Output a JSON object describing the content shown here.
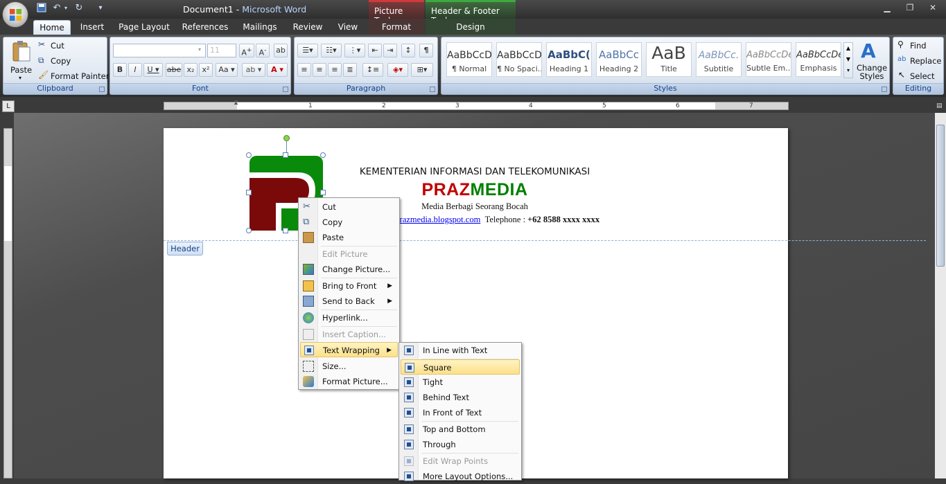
{
  "window": {
    "doc_name": "Document1",
    "app_name": "Microsoft Word",
    "separator": " - "
  },
  "contextual_tabs": {
    "picture_tools": "Picture Tools",
    "header_footer_tools": "Header & Footer Tools",
    "format": "Format",
    "design": "Design"
  },
  "tabs": [
    "Home",
    "Insert",
    "Page Layout",
    "References",
    "Mailings",
    "Review",
    "View"
  ],
  "clipboard": {
    "paste": "Paste",
    "cut": "Cut",
    "copy": "Copy",
    "format_painter": "Format Painter",
    "label": "Clipboard"
  },
  "font": {
    "size_value": "11",
    "label": "Font"
  },
  "paragraph": {
    "label": "Paragraph"
  },
  "styles": {
    "label": "Styles",
    "change_styles": "Change Styles",
    "items": [
      {
        "preview": "AaBbCcDc",
        "name": "¶ Normal"
      },
      {
        "preview": "AaBbCcDc",
        "name": "¶ No Spaci..."
      },
      {
        "preview": "AaBbC(",
        "name": "Heading 1"
      },
      {
        "preview": "AaBbCc",
        "name": "Heading 2"
      },
      {
        "preview": "AaB",
        "name": "Title"
      },
      {
        "preview": "AaBbCc.",
        "name": "Subtitle"
      },
      {
        "preview": "AaBbCcDe",
        "name": "Subtle Em..."
      },
      {
        "preview": "AaBbCcDe",
        "name": "Emphasis"
      }
    ]
  },
  "editing": {
    "find": "Find",
    "replace": "Replace",
    "select": "Select",
    "label": "Editing"
  },
  "ruler": {
    "numbers": [
      "1",
      "2",
      "3",
      "4",
      "5",
      "6",
      "7"
    ]
  },
  "document": {
    "line1": "KEMENTERIAN INFORMASI DAN TELEKOMUNIKASI",
    "brand_a": "PRAZ",
    "brand_b": "MEDIA",
    "line3": "Media Berbagi Seorang Bocah",
    "url": "://prazmedia.blogspot.com",
    "phone_label": "Telephone : ",
    "phone": "+62 8588  xxxx  xxxx",
    "header_tag": "Header",
    "colors": {
      "praz": "#c00000",
      "media": "#008000"
    }
  },
  "context_menu": {
    "items": [
      {
        "label": "Cut",
        "icon": "scissors-icon"
      },
      {
        "label": "Copy",
        "icon": "copy-icon"
      },
      {
        "label": "Paste",
        "icon": "paste-icon"
      },
      {
        "label": "Edit Picture",
        "icon": ""
      },
      {
        "label": "Change Picture...",
        "icon": "change-picture-icon"
      },
      {
        "label": "Bring to Front",
        "icon": "bring-front-icon"
      },
      {
        "label": "Send to Back",
        "icon": "send-back-icon"
      },
      {
        "label": "Hyperlink...",
        "icon": "hyperlink-icon"
      },
      {
        "label": "Insert Caption...",
        "icon": "caption-icon"
      },
      {
        "label": "Text Wrapping",
        "icon": "text-wrap-icon"
      },
      {
        "label": "Size...",
        "icon": "size-icon"
      },
      {
        "label": "Format Picture...",
        "icon": "format-picture-icon"
      }
    ]
  },
  "wrap_submenu": {
    "items": [
      {
        "label": "In Line with Text"
      },
      {
        "label": "Square"
      },
      {
        "label": "Tight"
      },
      {
        "label": "Behind Text"
      },
      {
        "label": "In Front of Text"
      },
      {
        "label": "Top and Bottom"
      },
      {
        "label": "Through"
      },
      {
        "label": "Edit Wrap Points"
      },
      {
        "label": "More Layout Options..."
      }
    ]
  }
}
